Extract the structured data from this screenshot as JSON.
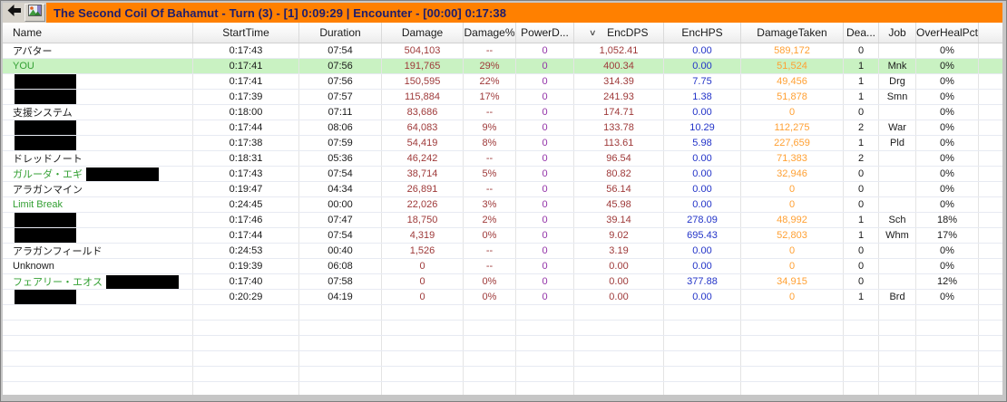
{
  "toolbar": {
    "back_icon": "back-arrow",
    "image_icon": "graph-image",
    "title": "The Second Coil Of Bahamut - Turn (3) - [1] 0:09:29 | Encounter - [00:00] 0:17:38"
  },
  "colors": {
    "title_bg": "#FF8000",
    "title_text": "#1C1C6E",
    "highlight_row_bg": "#C9F2C2",
    "green_name": "#34A034",
    "damage_text": "#9E3939",
    "power_text": "#9333A8",
    "hps_text": "#2233C8",
    "damage_taken_text": "#FFA033"
  },
  "table": {
    "sort_indicator": "∨",
    "sorted_column": "EncDPS",
    "columns": [
      {
        "key": "name",
        "label": "Name"
      },
      {
        "key": "start",
        "label": "StartTime"
      },
      {
        "key": "dur",
        "label": "Duration"
      },
      {
        "key": "dmg",
        "label": "Damage"
      },
      {
        "key": "pct",
        "label": "Damage%"
      },
      {
        "key": "pwr",
        "label": "PowerD..."
      },
      {
        "key": "dps",
        "label": "EncDPS",
        "sort": true
      },
      {
        "key": "hps",
        "label": "EncHPS"
      },
      {
        "key": "taken",
        "label": "DamageTaken"
      },
      {
        "key": "d",
        "label": "Dea..."
      },
      {
        "key": "job",
        "label": "Job"
      },
      {
        "key": "oh",
        "label": "OverHealPct"
      }
    ],
    "rows": [
      {
        "name": "アバター",
        "start": "0:17:43",
        "dur": "07:54",
        "dmg": "504,103",
        "pct": "--",
        "pwr": "0",
        "dps": "1,052.41",
        "hps": "0.00",
        "taken": "589,172",
        "d": "0",
        "job": "",
        "oh": "0%"
      },
      {
        "name": "YOU",
        "green": true,
        "hl": true,
        "start": "0:17:41",
        "dur": "07:56",
        "dmg": "191,765",
        "pct": "29%",
        "pwr": "0",
        "dps": "400.34",
        "hps": "0.00",
        "taken": "51,524",
        "d": "1",
        "job": "Mnk",
        "oh": "0%"
      },
      {
        "name": "",
        "censor": "full",
        "start": "0:17:41",
        "dur": "07:56",
        "dmg": "150,595",
        "pct": "22%",
        "pwr": "0",
        "dps": "314.39",
        "hps": "7.75",
        "taken": "49,456",
        "d": "1",
        "job": "Drg",
        "oh": "0%"
      },
      {
        "name": "",
        "censor": "full",
        "start": "0:17:39",
        "dur": "07:57",
        "dmg": "115,884",
        "pct": "17%",
        "pwr": "0",
        "dps": "241.93",
        "hps": "1.38",
        "taken": "51,878",
        "d": "1",
        "job": "Smn",
        "oh": "0%"
      },
      {
        "name": "支援システム",
        "start": "0:18:00",
        "dur": "07:11",
        "dmg": "83,686",
        "pct": "--",
        "pwr": "0",
        "dps": "174.71",
        "hps": "0.00",
        "taken": "0",
        "d": "0",
        "job": "",
        "oh": "0%"
      },
      {
        "name": "",
        "censor": "full",
        "start": "0:17:44",
        "dur": "08:06",
        "dmg": "64,083",
        "pct": "9%",
        "pwr": "0",
        "dps": "133.78",
        "hps": "10.29",
        "taken": "112,275",
        "d": "2",
        "job": "War",
        "oh": "0%"
      },
      {
        "name": "",
        "censor": "full",
        "start": "0:17:38",
        "dur": "07:59",
        "dmg": "54,419",
        "pct": "8%",
        "pwr": "0",
        "dps": "113.61",
        "hps": "5.98",
        "taken": "227,659",
        "d": "1",
        "job": "Pld",
        "oh": "0%"
      },
      {
        "name": "ドレッドノート",
        "start": "0:18:31",
        "dur": "05:36",
        "dmg": "46,242",
        "pct": "--",
        "pwr": "0",
        "dps": "96.54",
        "hps": "0.00",
        "taken": "71,383",
        "d": "2",
        "job": "",
        "oh": "0%"
      },
      {
        "name": "ガルーダ・エギ",
        "green": true,
        "censor": "after",
        "start": "0:17:43",
        "dur": "07:54",
        "dmg": "38,714",
        "pct": "5%",
        "pwr": "0",
        "dps": "80.82",
        "hps": "0.00",
        "taken": "32,946",
        "d": "0",
        "job": "",
        "oh": "0%"
      },
      {
        "name": "アラガンマイン",
        "start": "0:19:47",
        "dur": "04:34",
        "dmg": "26,891",
        "pct": "--",
        "pwr": "0",
        "dps": "56.14",
        "hps": "0.00",
        "taken": "0",
        "d": "0",
        "job": "",
        "oh": "0%"
      },
      {
        "name": "Limit Break",
        "green": true,
        "start": "0:24:45",
        "dur": "00:00",
        "dmg": "22,026",
        "pct": "3%",
        "pwr": "0",
        "dps": "45.98",
        "hps": "0.00",
        "taken": "0",
        "d": "0",
        "job": "",
        "oh": "0%"
      },
      {
        "name": "",
        "censor": "full",
        "start": "0:17:46",
        "dur": "07:47",
        "dmg": "18,750",
        "pct": "2%",
        "pwr": "0",
        "dps": "39.14",
        "hps": "278.09",
        "taken": "48,992",
        "d": "1",
        "job": "Sch",
        "oh": "18%"
      },
      {
        "name": "",
        "censor": "full",
        "start": "0:17:44",
        "dur": "07:54",
        "dmg": "4,319",
        "pct": "0%",
        "pwr": "0",
        "dps": "9.02",
        "hps": "695.43",
        "taken": "52,803",
        "d": "1",
        "job": "Whm",
        "oh": "17%"
      },
      {
        "name": "アラガンフィールド",
        "start": "0:24:53",
        "dur": "00:40",
        "dmg": "1,526",
        "pct": "--",
        "pwr": "0",
        "dps": "3.19",
        "hps": "0.00",
        "taken": "0",
        "d": "0",
        "job": "",
        "oh": "0%"
      },
      {
        "name": "Unknown",
        "start": "0:19:39",
        "dur": "06:08",
        "dmg": "0",
        "pct": "--",
        "pwr": "0",
        "dps": "0.00",
        "hps": "0.00",
        "taken": "0",
        "d": "0",
        "job": "",
        "oh": "0%"
      },
      {
        "name": "フェアリー・エオス",
        "green": true,
        "censor": "after",
        "start": "0:17:40",
        "dur": "07:58",
        "dmg": "0",
        "pct": "0%",
        "pwr": "0",
        "dps": "0.00",
        "hps": "377.88",
        "taken": "34,915",
        "d": "0",
        "job": "",
        "oh": "12%"
      },
      {
        "name": "",
        "censor": "full",
        "start": "0:20:29",
        "dur": "04:19",
        "dmg": "0",
        "pct": "0%",
        "pwr": "0",
        "dps": "0.00",
        "hps": "0.00",
        "taken": "0",
        "d": "1",
        "job": "Brd",
        "oh": "0%"
      }
    ],
    "empty_rows": 6
  }
}
